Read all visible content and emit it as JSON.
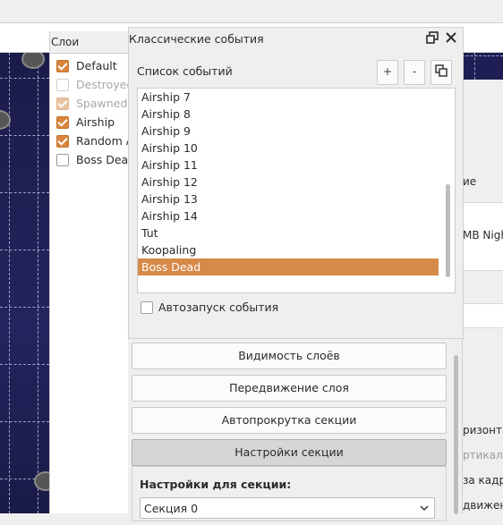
{
  "layers_panel": {
    "title": "Слои",
    "items": [
      {
        "label": "Default",
        "checked": true,
        "enabled": true
      },
      {
        "label": "Destroyed",
        "checked": false,
        "enabled": false
      },
      {
        "label": "Spawned N",
        "checked": true,
        "enabled": false
      },
      {
        "label": "Airship",
        "checked": true,
        "enabled": true
      },
      {
        "label": "Random A",
        "checked": true,
        "enabled": true
      },
      {
        "label": "Boss Dead",
        "checked": false,
        "enabled": true
      }
    ]
  },
  "dialog": {
    "title": "Классические события",
    "restore_icon": "restore-window-icon",
    "close_icon": "close-icon",
    "list_label": "Список событий",
    "add_label": "+",
    "remove_label": "-",
    "copy_icon": "duplicate-icon",
    "events": [
      "Airship 7",
      "Airship 8",
      "Airship 9",
      "Airship 10",
      "Airship 11",
      "Airship 12",
      "Airship 13",
      "Airship 14",
      "Tut",
      "Koopaling",
      "Boss Dead"
    ],
    "selected_event": "Boss Dead",
    "autostart_label": "Автозапуск события",
    "autostart_checked": false
  },
  "properties_panel": {
    "buttons": [
      "Видимость слоёв",
      "Передвижение слоя",
      "Автопрокрутка секции",
      "Настройки секции"
    ],
    "active_button": "Настройки секции",
    "settings_label": "Настройки для секции:",
    "section_select_value": "Секция 0"
  },
  "right_panel": {
    "header_fragment": "ие",
    "music_fragment": "MB Nigh",
    "option_1": "ризонта",
    "option_2": "ртикал",
    "option_3": "за кадр",
    "option_4": "движени"
  },
  "colors": {
    "accent": "#d68a48",
    "checkbox_on": "#d9853b",
    "canvas_bg": "#1e1e54"
  }
}
